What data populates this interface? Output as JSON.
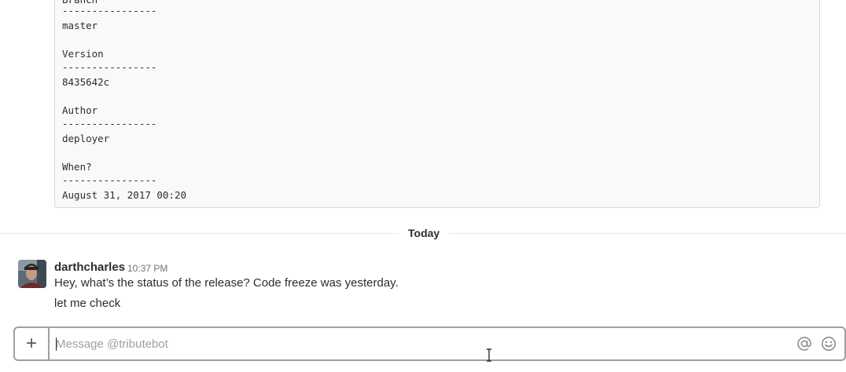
{
  "code_block": {
    "lines": [
      "Branch",
      "----------------",
      "master",
      "",
      "Version",
      "----------------",
      "8435642c",
      "",
      "Author",
      "----------------",
      "deployer",
      "",
      "When?",
      "----------------",
      "August 31, 2017 00:20"
    ]
  },
  "day_divider": {
    "label": "Today"
  },
  "message": {
    "author": "darthcharles",
    "time": "10:37 PM",
    "lines": [
      "Hey, what’s the status of the release? Code freeze was yesterday.",
      "let me check"
    ]
  },
  "composer": {
    "plus_label": "+",
    "placeholder": "Message @tributebot",
    "mention_icon": "at-sign-icon",
    "emoji_icon": "smiley-icon"
  },
  "colors": {
    "border": "#a0a0a2",
    "code_bg": "#f9f9f9",
    "muted_text": "#717274",
    "placeholder": "#9e9ea6"
  }
}
